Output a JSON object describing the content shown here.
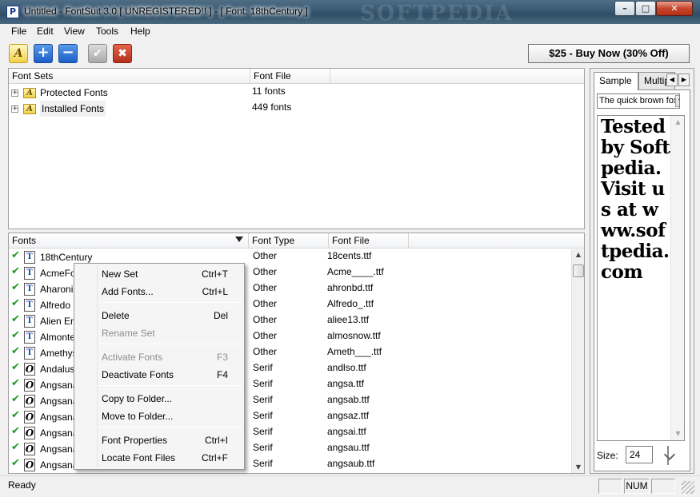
{
  "window": {
    "title": "Untitled - FontSuit 3.0 [ UNREGISTERED!! ]  -   [ Font:  18thCentury ]",
    "watermark": "SOFTPEDIA",
    "app_icon_glyph": "P",
    "min_glyph": "–",
    "max_glyph": "□",
    "close_glyph": "✕"
  },
  "menu": [
    "File",
    "Edit",
    "View",
    "Tools",
    "Help"
  ],
  "toolbar": {
    "folder_glyph": "A",
    "add_glyph": "+",
    "remove_glyph": "−",
    "activate_glyph": "✔",
    "deactivate_glyph": "✖",
    "buy_label": "$25 - Buy Now (30% Off)"
  },
  "font_sets": {
    "headers": [
      "Font Sets",
      "Font File"
    ],
    "rows": [
      {
        "name": "Protected Fonts",
        "file": "11 fonts"
      },
      {
        "name": "Installed Fonts",
        "file": "449 fonts"
      }
    ]
  },
  "fonts": {
    "headers": [
      "Fonts",
      "Font Type",
      "Font File"
    ],
    "rows": [
      {
        "name": "18thCentury",
        "type": "Other",
        "file": "18cents.ttf",
        "icon": "T"
      },
      {
        "name": "AcmeFont",
        "type": "Other",
        "file": "Acme____.ttf",
        "icon": "T"
      },
      {
        "name": "Aharoni",
        "type": "Other",
        "file": "ahronbd.ttf",
        "icon": "T"
      },
      {
        "name": "Alfredo",
        "type": "Other",
        "file": "Alfredo_.ttf",
        "icon": "T"
      },
      {
        "name": "Alien Encounters",
        "type": "Other",
        "file": "aliee13.ttf",
        "icon": "T"
      },
      {
        "name": "Almonte",
        "type": "Other",
        "file": "almosnow.ttf",
        "icon": "T"
      },
      {
        "name": "Amethyst",
        "type": "Other",
        "file": "Ameth___.ttf",
        "icon": "T"
      },
      {
        "name": "Andalus",
        "type": "Serif",
        "file": "andlso.ttf",
        "icon": "O"
      },
      {
        "name": "Angsana New",
        "type": "Serif",
        "file": "angsa.ttf",
        "icon": "O"
      },
      {
        "name": "Angsana New",
        "type": "Serif",
        "file": "angsab.ttf",
        "icon": "O"
      },
      {
        "name": "Angsana New",
        "type": "Serif",
        "file": "angsaz.ttf",
        "icon": "O"
      },
      {
        "name": "Angsana New",
        "type": "Serif",
        "file": "angsai.ttf",
        "icon": "O"
      },
      {
        "name": "Angsana New",
        "type": "Serif",
        "file": "angsau.ttf",
        "icon": "O"
      },
      {
        "name": "Angsana New",
        "type": "Serif",
        "file": "angsaub.ttf",
        "icon": "O"
      }
    ]
  },
  "context_menu": {
    "items": [
      {
        "label": "New Set",
        "shortcut": "Ctrl+T",
        "disabled": false
      },
      {
        "label": "Add Fonts...",
        "shortcut": "Ctrl+L",
        "disabled": false
      },
      {
        "label": "Delete",
        "shortcut": "Del",
        "disabled": false
      },
      {
        "label": "Rename Set",
        "shortcut": "",
        "disabled": true
      },
      {
        "label": "Activate Fonts",
        "shortcut": "F3",
        "disabled": true
      },
      {
        "label": "Deactivate Fonts",
        "shortcut": "F4",
        "disabled": false
      },
      {
        "label": "Copy to Folder...",
        "shortcut": "",
        "disabled": false
      },
      {
        "label": "Move to Folder...",
        "shortcut": "",
        "disabled": false
      },
      {
        "label": "Font Properties",
        "shortcut": "Ctrl+I",
        "disabled": false
      },
      {
        "label": "Locate Font Files",
        "shortcut": "Ctrl+F",
        "disabled": false
      }
    ]
  },
  "preview": {
    "tab_sample": "Sample",
    "tab_multiple": "Multiple",
    "sample_select": "The quick brown fox",
    "sample_text": "Tested by Softpedia. Visit us at www.softpedia.com",
    "size_label": "Size:",
    "size_value": "24"
  },
  "status": {
    "text": "Ready",
    "num": "NUM"
  },
  "colors": {
    "check": "#1d9b1d",
    "close_button": "#c7452c"
  }
}
